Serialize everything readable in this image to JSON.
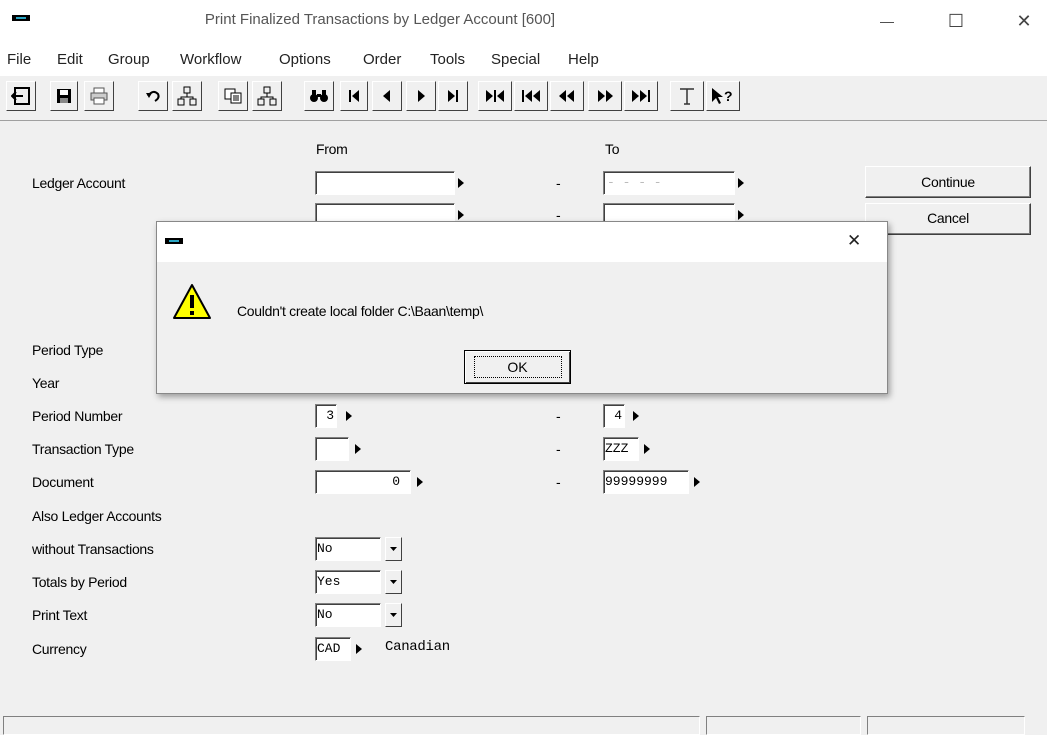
{
  "window": {
    "title": "Print Finalized Transactions by Ledger Account [600]",
    "minimize": "—",
    "maximize": "☐",
    "close": "✕"
  },
  "menu": [
    "File",
    "Edit",
    "Group",
    "Workflow",
    "Options",
    "Order",
    "Tools",
    "Special",
    "Help"
  ],
  "form": {
    "col_from": "From",
    "col_to": "To",
    "dash": "-",
    "rows": {
      "ledger_account": {
        "label": "Ledger Account",
        "from": "",
        "to": "- - - -"
      },
      "ledger_account_2": {
        "from": "",
        "to": ""
      },
      "period_type": {
        "label": "Period Type"
      },
      "year": {
        "label": "Year"
      },
      "period_number": {
        "label": "Period Number",
        "from": "3",
        "to": "4"
      },
      "transaction_type": {
        "label": "Transaction Type",
        "from": "",
        "to": "ZZZ"
      },
      "document": {
        "label": "Document",
        "from": "0",
        "to": "99999999"
      },
      "also_ledger": {
        "label": "Also Ledger Accounts"
      },
      "without_tx": {
        "label": "without Transactions",
        "value": "No"
      },
      "totals_by_period": {
        "label": "Totals by Period",
        "value": "Yes"
      },
      "print_text": {
        "label": "Print Text",
        "value": "No"
      },
      "currency": {
        "label": "Currency",
        "value": "CAD",
        "description": "Canadian"
      }
    }
  },
  "buttons": {
    "continue": "Continue",
    "cancel": "Cancel"
  },
  "dialog": {
    "message": "Couldn't create local folder C:\\Baan\\temp\\",
    "ok": "OK",
    "close": "✕"
  },
  "colors": {
    "warning_yellow": "#ffff00",
    "app_icon_blue": "#2aa6c4"
  }
}
